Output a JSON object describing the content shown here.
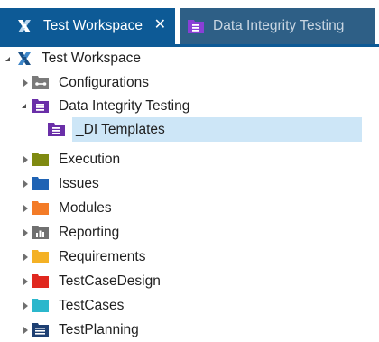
{
  "tabs": [
    {
      "label": "Test Workspace",
      "active": true,
      "icon": "workspace-x-icon",
      "close": "✕"
    },
    {
      "label": "Data Integrity Testing",
      "active": false,
      "icon": "purple-folder-doc-icon"
    }
  ],
  "tree": {
    "root": {
      "label": "Test Workspace",
      "icon": "workspace-x-icon",
      "expanded": true
    },
    "items": [
      {
        "label": "Configurations",
        "icon": "configuration-icon",
        "color": "#7a7a7a",
        "expanded": false
      },
      {
        "label": "Data Integrity Testing",
        "icon": "purple-folder-doc-icon",
        "color": "#6a2fa8",
        "expanded": true
      },
      {
        "label": "_DI Templates",
        "icon": "purple-folder-doc-icon",
        "color": "#6a2fa8",
        "selected": true
      },
      {
        "label": "Execution",
        "icon": "olive-folder-icon",
        "color": "#7f8a11",
        "expanded": false
      },
      {
        "label": "Issues",
        "icon": "blue-folder-icon",
        "color": "#1f63b4",
        "expanded": false
      },
      {
        "label": "Modules",
        "icon": "orange-folder-icon",
        "color": "#f37b27",
        "expanded": false
      },
      {
        "label": "Reporting",
        "icon": "report-chart-icon",
        "color": "#707070",
        "expanded": false
      },
      {
        "label": "Requirements",
        "icon": "yellow-folder-icon",
        "color": "#f4b125",
        "expanded": false
      },
      {
        "label": "TestCaseDesign",
        "icon": "red-folder-icon",
        "color": "#e0281f",
        "expanded": false
      },
      {
        "label": "TestCases",
        "icon": "cyan-folder-icon",
        "color": "#2bb7cc",
        "expanded": false
      },
      {
        "label": "TestPlanning",
        "icon": "navy-list-icon",
        "color": "#1d3f72",
        "expanded": false
      }
    ]
  }
}
